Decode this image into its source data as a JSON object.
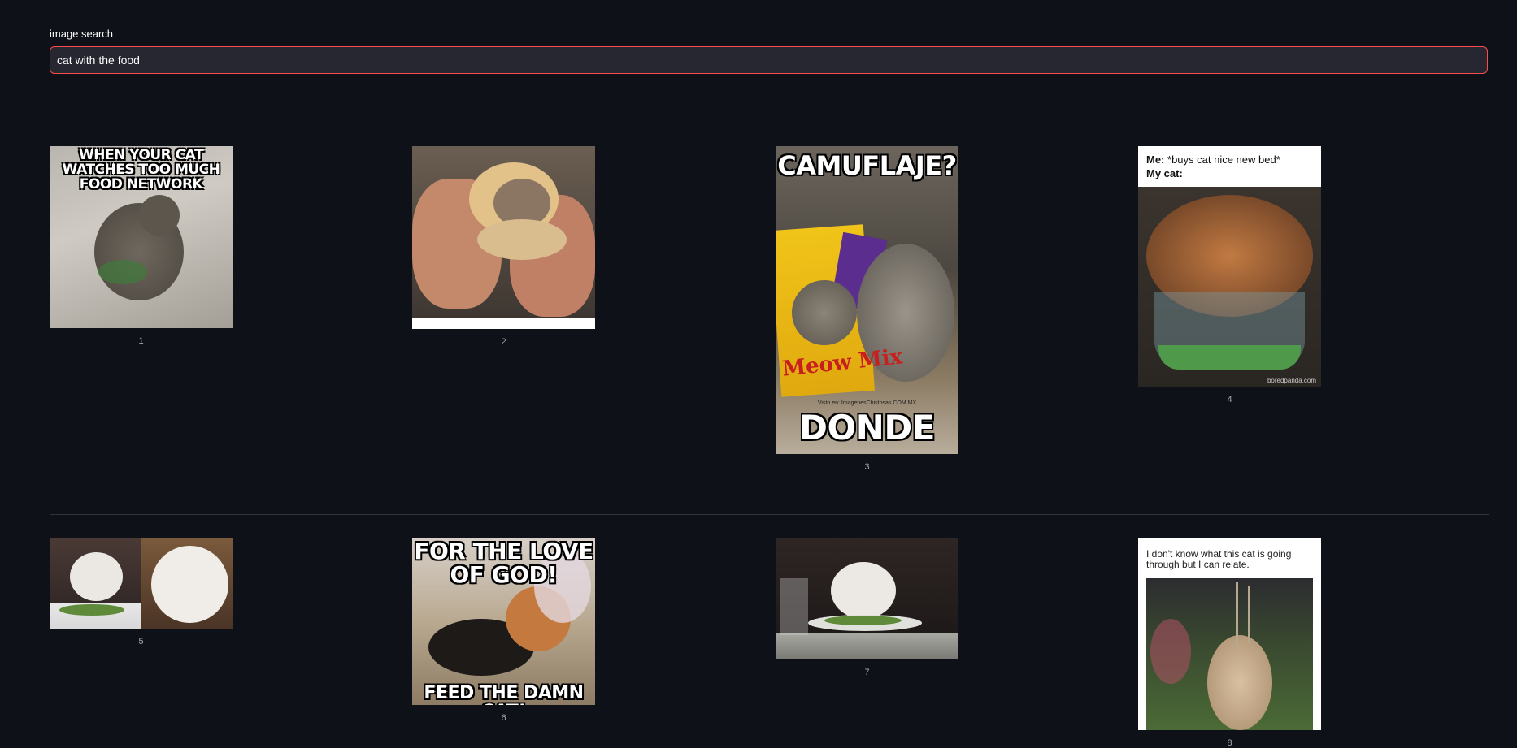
{
  "search": {
    "label": "image search",
    "value": "cat with the food",
    "placeholder": ""
  },
  "images": [
    {
      "caption": "1",
      "text_top": "WHEN YOUR CAT WATCHES TOO MUCH FOOD NETWORK",
      "text_bottom": ""
    },
    {
      "caption": "2",
      "text_top": "",
      "text_bottom": ""
    },
    {
      "caption": "3",
      "text_top": "CAMUFLAJE?",
      "text_bottom": "DONDE",
      "bag_text": "Meow Mix",
      "small_text": "Visto en: ImagenesChistosas.COM.MX"
    },
    {
      "caption": "4",
      "text_top_bold": "Me:",
      "text_top": "*buys cat nice new bed*",
      "text_second_bold": "My cat:",
      "watermark": "boredpanda.com"
    },
    {
      "caption": "5",
      "text_top": "",
      "text_bottom": ""
    },
    {
      "caption": "6",
      "text_top": "FOR THE LOVE OF GOD!",
      "text_bottom": "FEED THE DAMN CAT!"
    },
    {
      "caption": "7",
      "text_top": "",
      "text_bottom": ""
    },
    {
      "caption": "8",
      "text_top": "I don't know what this cat is going through but I can relate."
    }
  ],
  "colors": {
    "background": "#0e1117",
    "input_bg": "#262730",
    "input_border": "#ff4b4b",
    "divider": "#31333f",
    "caption": "#a3a8b8"
  }
}
